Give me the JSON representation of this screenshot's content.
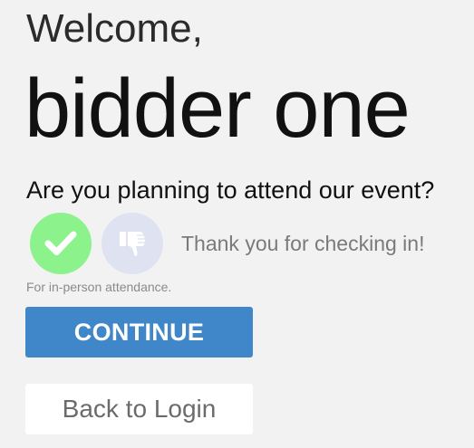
{
  "greeting": {
    "line1": "Welcome,",
    "name": "bidder one"
  },
  "attendance": {
    "question": "Are you planning to attend our event?",
    "yes_icon": "checkmark-icon",
    "no_icon": "thumbs-down-icon",
    "yes_color": "#8cf28c",
    "no_color": "#dfe2f0",
    "confirmation": "Thank you for checking in!",
    "note": "For in-person attendance."
  },
  "actions": {
    "continue_label": "CONTINUE",
    "continue_color": "#3f87c8",
    "back_label": "Back to Login"
  }
}
